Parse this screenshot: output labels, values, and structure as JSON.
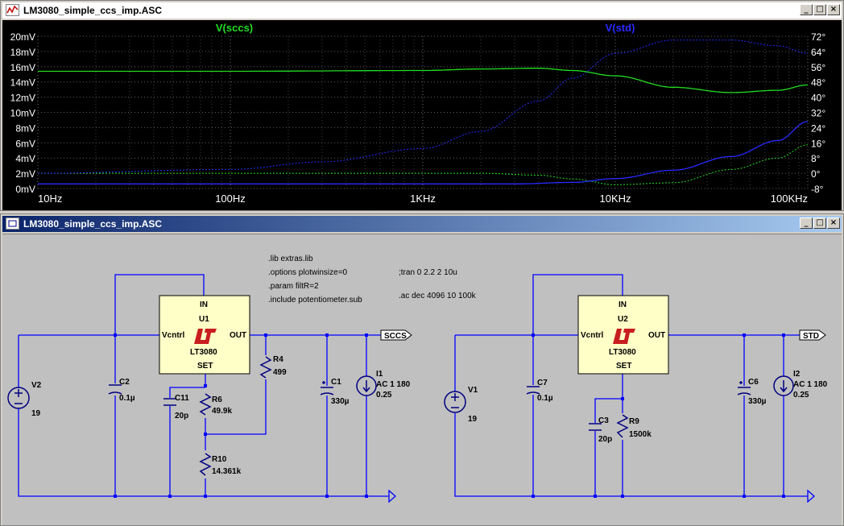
{
  "plot_window": {
    "title": "LM3080_simple_ccs_imp.ASC",
    "icon": "waveform-icon",
    "buttons": {
      "minimize": "_",
      "maximize": "□",
      "close": "×"
    }
  },
  "schematic_window": {
    "title": "LM3080_simple_ccs_imp.ASC",
    "icon": "schematic-icon",
    "buttons": {
      "minimize": "_",
      "maximize": "□",
      "close": "×"
    }
  },
  "chart_data": {
    "type": "line",
    "xscale": "log",
    "xlim": [
      10,
      100000
    ],
    "x_ticks": [
      "10Hz",
      "100Hz",
      "1KHz",
      "10KHz",
      "100KHz"
    ],
    "left_axis": {
      "ticks": [
        "20mV",
        "18mV",
        "16mV",
        "14mV",
        "12mV",
        "10mV",
        "8mV",
        "6mV",
        "4mV",
        "2mV",
        "0mV"
      ],
      "lim": [
        0,
        20
      ],
      "unit": "mV"
    },
    "right_axis": {
      "ticks": [
        "72°",
        "64°",
        "56°",
        "48°",
        "40°",
        "32°",
        "24°",
        "16°",
        "8°",
        "0°",
        "-8°"
      ],
      "lim": [
        -8,
        72
      ],
      "unit": "deg"
    },
    "grid": true,
    "series": [
      {
        "name": "V(sccs)",
        "color": "#22dd22",
        "magnitude_mV": [
          [
            10,
            15.4
          ],
          [
            100,
            15.4
          ],
          [
            1000,
            15.5
          ],
          [
            2000,
            15.7
          ],
          [
            4000,
            15.8
          ],
          [
            6000,
            15.5
          ],
          [
            10000,
            14.8
          ],
          [
            20000,
            13.3
          ],
          [
            40000,
            12.6
          ],
          [
            70000,
            12.9
          ],
          [
            100000,
            13.6
          ]
        ],
        "phase_deg": [
          [
            10,
            0
          ],
          [
            1000,
            0
          ],
          [
            2000,
            0
          ],
          [
            4000,
            -1
          ],
          [
            6000,
            -3
          ],
          [
            10000,
            -6
          ],
          [
            20000,
            -5
          ],
          [
            40000,
            2
          ],
          [
            70000,
            8
          ],
          [
            100000,
            15
          ]
        ]
      },
      {
        "name": "V(std)",
        "color": "#2a2aff",
        "magnitude_mV": [
          [
            10,
            0.6
          ],
          [
            100,
            0.6
          ],
          [
            1000,
            0.6
          ],
          [
            3000,
            0.6
          ],
          [
            6000,
            0.8
          ],
          [
            10000,
            1.3
          ],
          [
            20000,
            2.4
          ],
          [
            40000,
            4.2
          ],
          [
            70000,
            6.3
          ],
          [
            100000,
            8.8
          ]
        ],
        "phase_deg": [
          [
            10,
            0
          ],
          [
            100,
            2
          ],
          [
            300,
            6
          ],
          [
            1000,
            13
          ],
          [
            2000,
            22
          ],
          [
            4000,
            38
          ],
          [
            6000,
            50
          ],
          [
            10000,
            63
          ],
          [
            20000,
            70
          ],
          [
            40000,
            70
          ],
          [
            70000,
            67
          ],
          [
            100000,
            63
          ]
        ]
      }
    ]
  },
  "schematic": {
    "directives": [
      ".lib extras.lib",
      ".options plotwinsize=0",
      ".param filtR=2",
      ".include potentiometer.sub"
    ],
    "directives_right": [
      ";tran 0 2.2 2 10u",
      ".ac dec 4096 10 100k"
    ],
    "u1": {
      "pin_in": "IN",
      "ref": "U1",
      "pin_vctrl": "Vcntrl",
      "pin_out": "OUT",
      "part": "LT3080",
      "pin_set": "SET"
    },
    "u2": {
      "pin_in": "IN",
      "ref": "U2",
      "pin_vctrl": "Vcntrl",
      "pin_out": "OUT",
      "part": "LT3080",
      "pin_set": "SET"
    },
    "v2": {
      "ref": "V2",
      "value": "19"
    },
    "v1": {
      "ref": "V1",
      "value": "19"
    },
    "c2": {
      "ref": "C2",
      "value": "0.1µ"
    },
    "c7": {
      "ref": "C7",
      "value": "0.1µ"
    },
    "c11": {
      "ref": "C11",
      "value": "20p"
    },
    "c3": {
      "ref": "C3",
      "value": "20p"
    },
    "r6": {
      "ref": "R6",
      "value": "49.9k"
    },
    "r10": {
      "ref": "R10",
      "value": "14.361k"
    },
    "r4": {
      "ref": "R4",
      "value": "499"
    },
    "r9": {
      "ref": "R9",
      "value": "1500k"
    },
    "c1": {
      "ref": "C1",
      "value": "330µ"
    },
    "c6": {
      "ref": "C6",
      "value": "330µ"
    },
    "i1": {
      "ref": "I1",
      "value1": "AC 1 180",
      "value2": "0.25"
    },
    "i2": {
      "ref": "I2",
      "value1": "AC 1 180",
      "value2": "0.25"
    },
    "label_sccs": "SCCS",
    "label_std": "STD"
  },
  "colors": {
    "wire": "#0000ff",
    "component": "#000080",
    "part_fill": "#ffffc8",
    "lt_logo": "#c81e1e"
  }
}
